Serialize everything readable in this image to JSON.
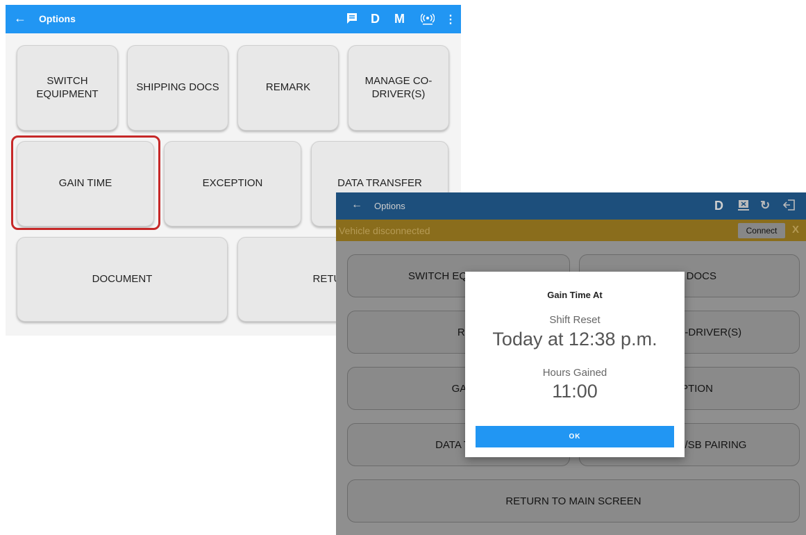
{
  "screen1": {
    "header": {
      "back_icon": "arrow-back-icon",
      "title": "Options",
      "icons": [
        "message-icon",
        "D",
        "M",
        "wifi-signal-icon",
        "more-icon"
      ]
    },
    "tiles": [
      {
        "label": "SWITCH\nEQUIPMENT"
      },
      {
        "label": "SHIPPING DOCS"
      },
      {
        "label": "REMARK"
      },
      {
        "label": "MANAGE CO-\nDRIVER(S)"
      },
      {
        "label": "GAIN TIME"
      },
      {
        "label": "EXCEPTION"
      },
      {
        "label": "DATA TRANSFER"
      },
      {
        "label": "DOCUMENT"
      },
      {
        "label": "RETURN TO"
      }
    ],
    "highlight_color": "#c62828"
  },
  "screen2": {
    "header": {
      "back_icon": "arrow-back-icon",
      "title": "Options",
      "icons": [
        "D",
        "device-icon",
        "refresh-icon",
        "logout-icon"
      ]
    },
    "banner": {
      "message": "Vehicle disconnected",
      "connect_label": "Connect",
      "close_label": "X"
    },
    "tiles": [
      {
        "label": "SWITCH EQ"
      },
      {
        "label": "NG DOCS"
      },
      {
        "label": "REMA"
      },
      {
        "label": "CO-DRIVER(S)"
      },
      {
        "label": "GAIN T"
      },
      {
        "label": "EPTION"
      },
      {
        "label": "DATA TRA"
      },
      {
        "label": "/SB PAIRING"
      },
      {
        "label": "RETURN TO MAIN SCREEN"
      }
    ],
    "dialog": {
      "title": "Gain Time At",
      "shift_label": "Shift Reset",
      "shift_value": "Today at 12:38 p.m.",
      "hours_label": "Hours Gained",
      "hours_value": "11:00",
      "ok_label": "OK"
    }
  },
  "colors": {
    "primary": "#2196f3",
    "appbar_dim": "#1d4f7c",
    "banner": "#8a6d1c"
  }
}
